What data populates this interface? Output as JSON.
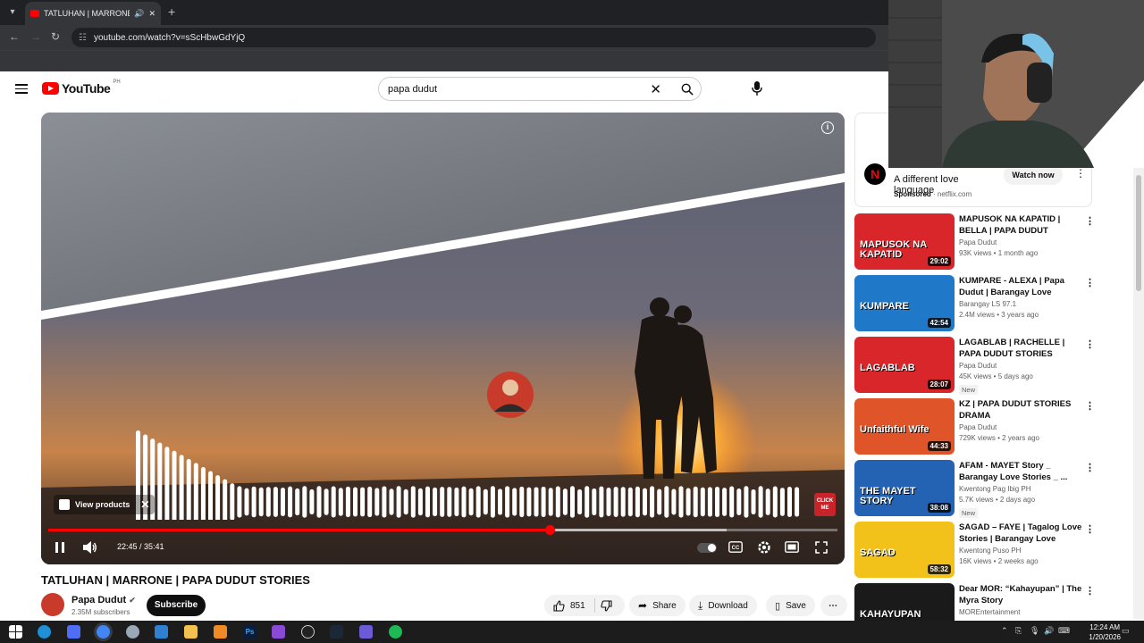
{
  "browser": {
    "tab_title": "TATLUHAN | MARRONE | PA",
    "url": "youtube.com/watch?v=sScHbwGdYjQ"
  },
  "header": {
    "logo_text": "YouTube",
    "country_code": "PH",
    "search_query": "papa dudut"
  },
  "player": {
    "view_products": "View products",
    "current_time": "22:45 / 35:41",
    "progress": 0.635,
    "buffered": 0.86,
    "click_me": "CLICK ME"
  },
  "video": {
    "title": "TATLUHAN | MARRONE | PAPA DUDUT STORIES",
    "channel": "Papa Dudut",
    "subscribers": "2.35M subscribers",
    "subscribe_label": "Subscribe",
    "likes": "851",
    "share_label": "Share",
    "download_label": "Download",
    "save_label": "Save"
  },
  "ad": {
    "text_line1": "A different love",
    "text_line2": "language",
    "sponsored": "Sponsored",
    "domain": "netflix.com",
    "cta": "Watch now"
  },
  "recommendations": [
    {
      "title": "MAPUSOK NA KAPATID | BELLA | PAPA DUDUT STORIES",
      "channel": "Papa Dudut",
      "meta": "93K views • 1 month ago",
      "duration": "29:02",
      "thumb_text": "MAPUSOK NA KAPATID",
      "badge": ""
    },
    {
      "title": "KUMPARE - ALEXA | Papa Dudut | Barangay Love Stories",
      "channel": "Barangay LS 97.1",
      "meta": "2.4M views • 3 years ago",
      "duration": "42:54",
      "thumb_text": "KUMPARE",
      "badge": ""
    },
    {
      "title": "LAGABLAB | RACHELLE | PAPA DUDUT STORIES",
      "channel": "Papa Dudut",
      "meta": "45K views • 5 days ago",
      "duration": "28:07",
      "thumb_text": "LAGABLAB",
      "badge": "New"
    },
    {
      "title": "KZ | PAPA DUDUT STORIES DRAMA",
      "channel": "Papa Dudut",
      "meta": "729K views • 2 years ago",
      "duration": "44:33",
      "thumb_text": "Unfaithful Wife",
      "badge": ""
    },
    {
      "title": "AFAM - MAYET Story _ Barangay Love Stories _ ...",
      "channel": "Kwentong Pag Ibig PH",
      "meta": "5.7K views • 2 days ago",
      "duration": "38:08",
      "thumb_text": "THE MAYET STORY",
      "badge": "New"
    },
    {
      "title": "SAGAD – FAYE | Tagalog Love Stories | Barangay Love Storie...",
      "channel": "Kwentong Puso PH",
      "meta": "16K views • 2 weeks ago",
      "duration": "58:32",
      "thumb_text": "SAGAD",
      "badge": ""
    },
    {
      "title": "Dear MOR: “Kahayupan” | The Myra Story",
      "channel": "MOREntertainment",
      "meta": "",
      "duration": "",
      "thumb_text": "KAHAYUPAN",
      "badge": ""
    }
  ],
  "taskbar": {
    "time": "12:24 AM",
    "date": "1/20/2026"
  },
  "colors": {
    "youtube_red": "#ff0000",
    "chrome_dark": "#202124",
    "taskbar": "#1c1c1c"
  }
}
